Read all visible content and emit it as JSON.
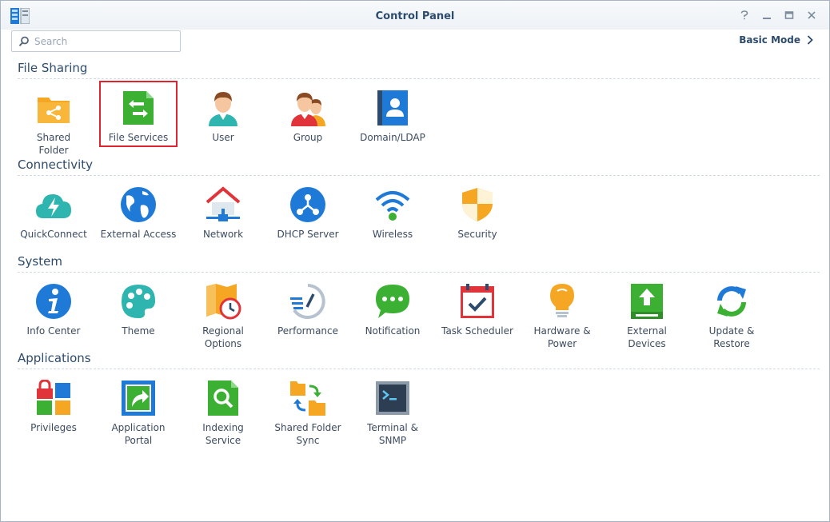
{
  "window": {
    "title": "Control Panel",
    "controls": [
      "help-icon",
      "minimize-icon",
      "maximize-icon",
      "close-icon"
    ]
  },
  "search": {
    "placeholder": "Search",
    "value": ""
  },
  "header": {
    "basic_mode_label": "Basic Mode"
  },
  "colors": {
    "accent": "#2d4b6d",
    "selection_border": "#e0242f",
    "green": "#3bb033",
    "orange": "#f5a623",
    "blue": "#1f7ad7",
    "teal": "#2fb5b0"
  },
  "sections": [
    {
      "title": "File Sharing",
      "items": [
        {
          "label": "Shared\nFolder",
          "icon": "shared-folder-icon"
        },
        {
          "label": "File Services",
          "icon": "file-services-icon",
          "selected": true
        },
        {
          "label": "User",
          "icon": "user-icon"
        },
        {
          "label": "Group",
          "icon": "group-icon"
        },
        {
          "label": "Domain/LDAP",
          "icon": "domain-ldap-icon"
        }
      ]
    },
    {
      "title": "Connectivity",
      "items": [
        {
          "label": "QuickConnect",
          "icon": "quickconnect-icon"
        },
        {
          "label": "External Access",
          "icon": "external-access-icon"
        },
        {
          "label": "Network",
          "icon": "network-icon"
        },
        {
          "label": "DHCP Server",
          "icon": "dhcp-server-icon"
        },
        {
          "label": "Wireless",
          "icon": "wireless-icon"
        },
        {
          "label": "Security",
          "icon": "security-icon"
        }
      ]
    },
    {
      "title": "System",
      "items": [
        {
          "label": "Info Center",
          "icon": "info-center-icon"
        },
        {
          "label": "Theme",
          "icon": "theme-icon"
        },
        {
          "label": "Regional\nOptions",
          "icon": "regional-options-icon"
        },
        {
          "label": "Performance",
          "icon": "performance-icon"
        },
        {
          "label": "Notification",
          "icon": "notification-icon"
        },
        {
          "label": "Task Scheduler",
          "icon": "task-scheduler-icon"
        },
        {
          "label": "Hardware &\nPower",
          "icon": "hardware-power-icon"
        },
        {
          "label": "External\nDevices",
          "icon": "external-devices-icon"
        },
        {
          "label": "Update &\nRestore",
          "icon": "update-restore-icon"
        }
      ]
    },
    {
      "title": "Applications",
      "items": [
        {
          "label": "Privileges",
          "icon": "privileges-icon"
        },
        {
          "label": "Application\nPortal",
          "icon": "application-portal-icon"
        },
        {
          "label": "Indexing\nService",
          "icon": "indexing-service-icon"
        },
        {
          "label": "Shared Folder\nSync",
          "icon": "shared-folder-sync-icon"
        },
        {
          "label": "Terminal &\nSNMP",
          "icon": "terminal-snmp-icon"
        }
      ]
    }
  ]
}
